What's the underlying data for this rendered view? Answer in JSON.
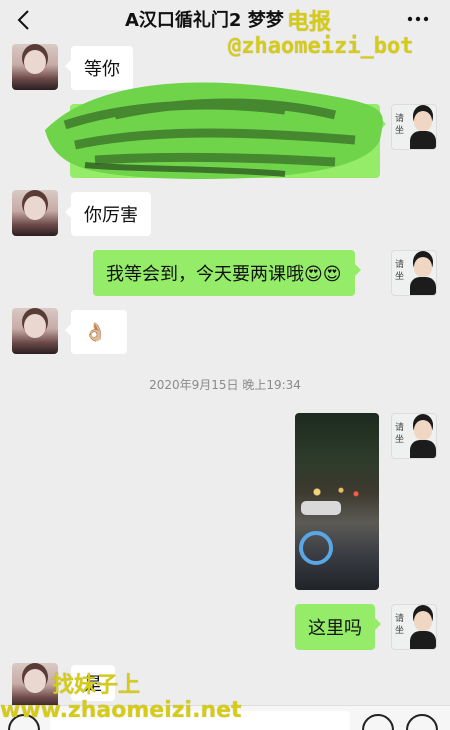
{
  "header": {
    "title": "A汉口循礼门2 梦梦",
    "back_icon": "chevron-left-icon",
    "more_icon": "ellipsis-icon"
  },
  "watermarks": {
    "top_cn": "电报",
    "top_handle": "@zhaomeizi_bot",
    "bottom_cn": "找妹子上",
    "bottom_url": "www.zhaomeizi.net"
  },
  "messages": [
    {
      "side": "left",
      "text": "等你"
    },
    {
      "side": "right",
      "text": "",
      "obscured": true
    },
    {
      "side": "left",
      "text": "你厉害"
    },
    {
      "side": "right",
      "text": "我等会到，今天要两课哦😍😍"
    },
    {
      "side": "left",
      "text": "👌🏼"
    },
    {
      "side": "right",
      "type": "photo"
    },
    {
      "side": "right",
      "text": "这里吗"
    },
    {
      "side": "left",
      "text": "是"
    }
  ],
  "timestamp": "2020年9月15日 晚上19:34",
  "avatar_seal": "请坐",
  "colors": {
    "background": "#ededed",
    "outgoing_bubble": "#95ec69",
    "incoming_bubble": "#ffffff",
    "watermark": "#d6cc16"
  }
}
